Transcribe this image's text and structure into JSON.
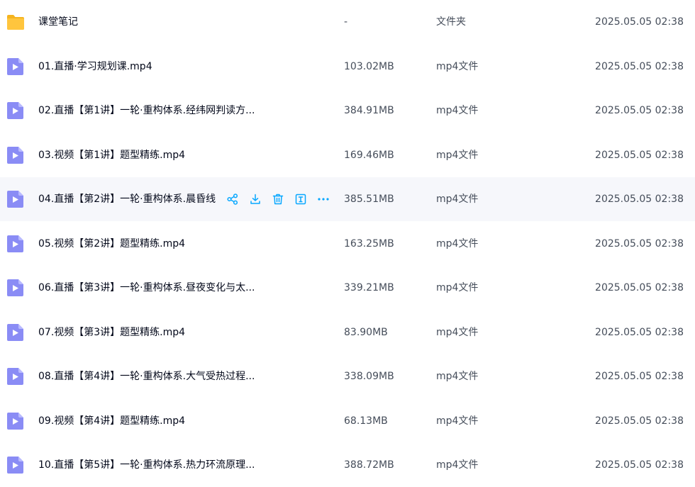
{
  "colors": {
    "accent": "#06a7ff",
    "folder": "#ffc53d",
    "video": "#8a8cf5",
    "hover_row": "#f6f7fb"
  },
  "files": [
    {
      "name": "课堂笔记",
      "size": "-",
      "type": "文件夹",
      "date": "2025.05.05 02:38",
      "icon": "folder-icon"
    },
    {
      "name": "01.直播·学习规划课.mp4",
      "size": "103.02MB",
      "type": "mp4文件",
      "date": "2025.05.05 02:38",
      "icon": "video-icon"
    },
    {
      "name": "02.直播【第1讲】一轮·重构体系.经纬网判读方...",
      "size": "384.91MB",
      "type": "mp4文件",
      "date": "2025.05.05 02:38",
      "icon": "video-icon"
    },
    {
      "name": "03.视频【第1讲】题型精练.mp4",
      "size": "169.46MB",
      "type": "mp4文件",
      "date": "2025.05.05 02:38",
      "icon": "video-icon"
    },
    {
      "name": "04.直播【第2讲】一轮·重构体系.晨昏线",
      "size": "385.51MB",
      "type": "mp4文件",
      "date": "2025.05.05 02:38",
      "icon": "video-icon",
      "hover": true
    },
    {
      "name": "05.视频【第2讲】题型精练.mp4",
      "size": "163.25MB",
      "type": "mp4文件",
      "date": "2025.05.05 02:38",
      "icon": "video-icon"
    },
    {
      "name": "06.直播【第3讲】一轮·重构体系.昼夜变化与太...",
      "size": "339.21MB",
      "type": "mp4文件",
      "date": "2025.05.05 02:38",
      "icon": "video-icon"
    },
    {
      "name": "07.视频【第3讲】题型精练.mp4",
      "size": "83.90MB",
      "type": "mp4文件",
      "date": "2025.05.05 02:38",
      "icon": "video-icon"
    },
    {
      "name": "08.直播【第4讲】一轮·重构体系.大气受热过程...",
      "size": "338.09MB",
      "type": "mp4文件",
      "date": "2025.05.05 02:38",
      "icon": "video-icon"
    },
    {
      "name": "09.视频【第4讲】题型精练.mp4",
      "size": "68.13MB",
      "type": "mp4文件",
      "date": "2025.05.05 02:38",
      "icon": "video-icon"
    },
    {
      "name": "10.直播【第5讲】一轮·重构体系.热力环流原理...",
      "size": "388.72MB",
      "type": "mp4文件",
      "date": "2025.05.05 02:38",
      "icon": "video-icon"
    }
  ],
  "hover_actions": [
    "share-icon",
    "download-icon",
    "delete-icon",
    "rename-icon",
    "more-icon"
  ]
}
